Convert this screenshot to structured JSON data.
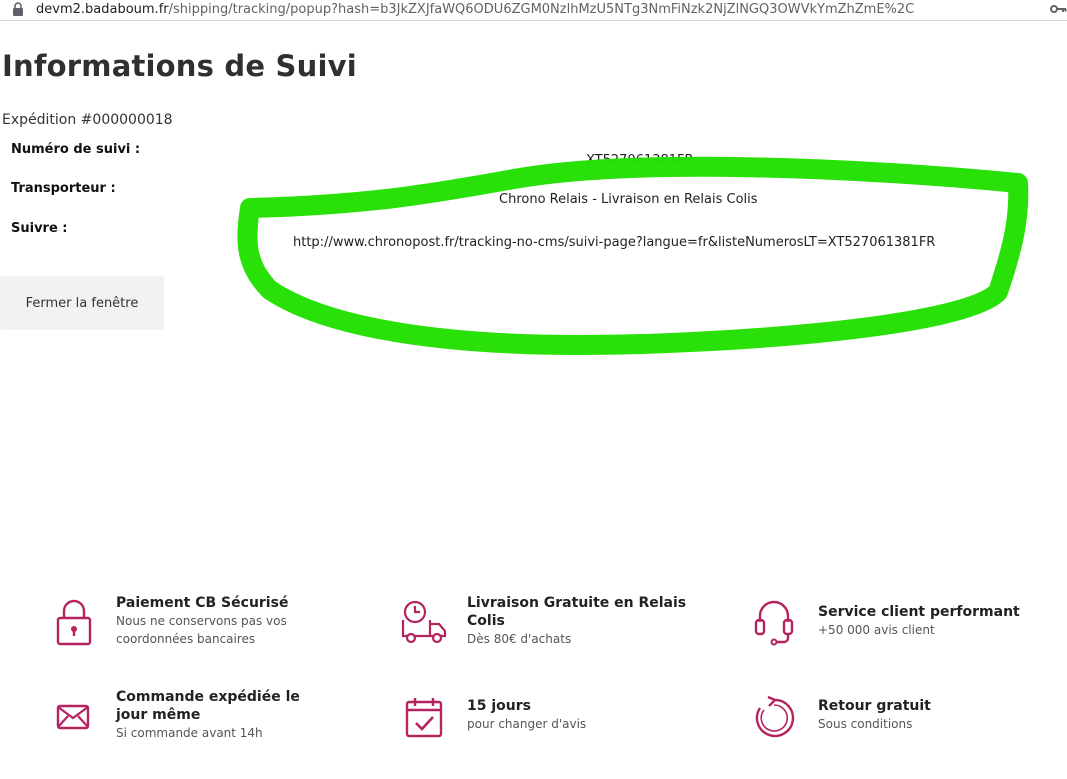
{
  "browser": {
    "url_host": "devm2.badaboum.fr",
    "url_path": "/shipping/tracking/popup?hash=b3JkZXJfaWQ6ODU6ZGM0NzlhMzU5NTg3NmFiNzk2NjZlNGQ3OWVkYmZhZmE%2C"
  },
  "page": {
    "title": "Informations de Suivi",
    "shipment": "Expédition #000000018"
  },
  "tracking": {
    "number_label": "Numéro de suivi :",
    "number_value": "XT527061381FR",
    "carrier_label": "Transporteur :",
    "carrier_value": "Chrono Relais - Livraison en Relais Colis",
    "follow_label": "Suivre :",
    "follow_value": "http://www.chronopost.fr/tracking-no-cms/suivi-page?langue=fr&listeNumerosLT=XT527061381FR"
  },
  "actions": {
    "close_label": "Fermer la fenêtre"
  },
  "features": [
    {
      "icon": "padlock-icon",
      "title": "Paiement CB Sécurisé",
      "desc1": "Nous ne conservons pas vos",
      "desc2": "coordonnées bancaires"
    },
    {
      "icon": "delivery-truck-icon",
      "title": "Livraison Gratuite en Relais",
      "title2": "Colis",
      "desc1": "Dès 80€ d'achats"
    },
    {
      "icon": "headset-icon",
      "title": "Service client performant",
      "desc1": "+50 000 avis client"
    },
    {
      "icon": "envelope-icon",
      "title": "Commande expédiée le",
      "title2": "jour même",
      "desc1": "Si commande avant 14h"
    },
    {
      "icon": "calendar-check-icon",
      "title": "15 jours",
      "desc1": "pour changer d'avis"
    },
    {
      "icon": "return-arrow-icon",
      "title": "Retour gratuit",
      "desc1": "Sous conditions"
    }
  ],
  "colors": {
    "accent": "#b5245f",
    "highlight": "#22e000"
  }
}
